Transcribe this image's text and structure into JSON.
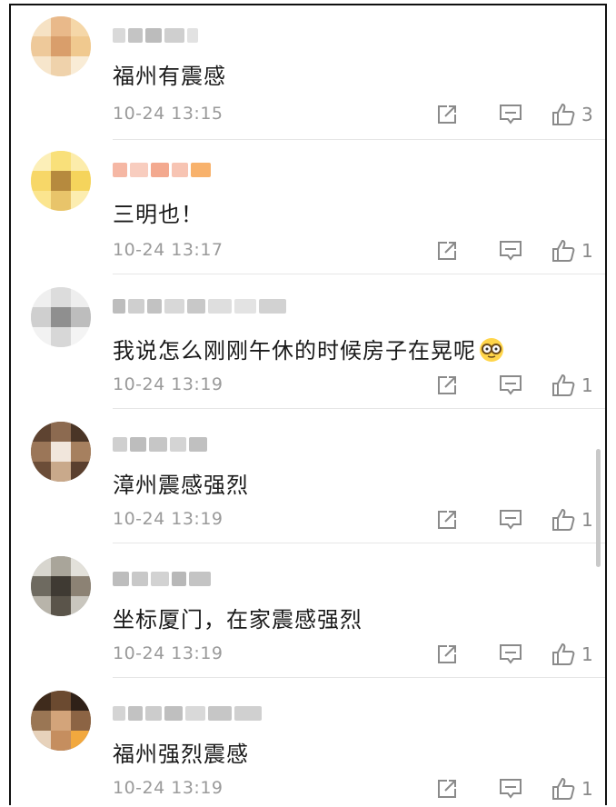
{
  "comments": [
    {
      "username": "",
      "text": "福州有震感",
      "time": "10-24 13:15",
      "likes": "3"
    },
    {
      "username": "",
      "text": "三明也！",
      "time": "10-24 13:17",
      "likes": "1"
    },
    {
      "username": "",
      "text": "我说怎么刚刚午休的时候房子在晃呢",
      "time": "10-24 13:19",
      "likes": "1"
    },
    {
      "username": "",
      "text": "漳州震感强烈",
      "time": "10-24 13:19",
      "likes": "1"
    },
    {
      "username": "",
      "text": "坐标厦门，在家震感强烈",
      "time": "10-24 13:19",
      "likes": "1"
    },
    {
      "username": "",
      "text": "福州强烈震感",
      "time": "10-24 13:19",
      "likes": "1"
    }
  ],
  "icons": {
    "share": "share-icon",
    "reply": "comment-icon",
    "like": "thumbs-up-icon",
    "emoji": "glasses-emoji-icon"
  },
  "colors": {
    "text": "#1a1a1a",
    "meta": "#9a9a9a",
    "icon": "#8a8a8a",
    "divider": "#e6e6e6"
  }
}
